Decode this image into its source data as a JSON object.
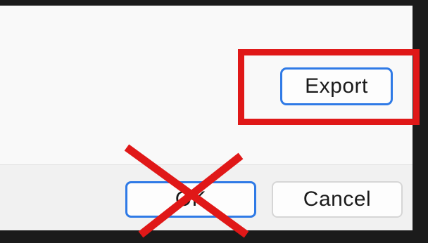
{
  "dialog": {
    "export_label": "Export",
    "ok_label": "OK",
    "cancel_label": "Cancel"
  },
  "annotations": {
    "highlight_color": "#e01818",
    "cross_color": "#e01818"
  },
  "colors": {
    "accent": "#2f7ae6",
    "dialog_background": "#f9f9f9",
    "footer_background": "#f1f1f1"
  }
}
